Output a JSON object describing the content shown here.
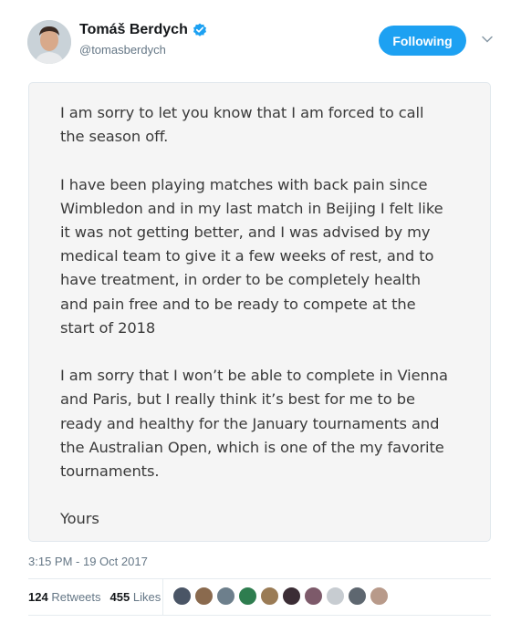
{
  "header": {
    "display_name": "Tomáš Berdych",
    "handle": "@tomasberdych",
    "follow_label": "Following"
  },
  "statement": {
    "paragraphs": [
      "I am sorry to let you know that I am forced to call\nthe season off.",
      "I have been playing matches with back pain since\nWimbledon and in my last match in Beijing I felt like\nit was not getting better, and I was advised by my\nmedical team to give it a few weeks of rest, and to\nhave treatment, in order to be completely health\nand pain free and to be ready to compete at the\nstart of 2018",
      "I am sorry that I won’t be able to complete in Vienna\nand Paris, but I really think it’s best for me to be\nready and healthy for the January tournaments and\nthe Australian Open, which is one of the my favorite\ntournaments.",
      "Yours"
    ]
  },
  "meta": {
    "timestamp": "3:15 PM - 19 Oct 2017",
    "retweets_count": "124",
    "retweets_label": "Retweets",
    "likes_count": "455",
    "likes_label": "Likes"
  },
  "likers": [
    {
      "name": "liker-avatar-1",
      "color": "#4a5566"
    },
    {
      "name": "liker-avatar-2",
      "color": "#8a6a4e"
    },
    {
      "name": "liker-avatar-3",
      "color": "#6d7f8c"
    },
    {
      "name": "liker-avatar-4",
      "color": "#2e7d4f"
    },
    {
      "name": "liker-avatar-5",
      "color": "#9a7b55"
    },
    {
      "name": "liker-avatar-6",
      "color": "#3b2d35"
    },
    {
      "name": "liker-avatar-7",
      "color": "#7d5a6a"
    },
    {
      "name": "liker-avatar-8",
      "color": "#c7ccd1"
    },
    {
      "name": "liker-avatar-9",
      "color": "#5e6770"
    },
    {
      "name": "liker-avatar-10",
      "color": "#b89a8a"
    }
  ],
  "colors": {
    "accent": "#1da1f2",
    "muted_text": "#657786"
  }
}
